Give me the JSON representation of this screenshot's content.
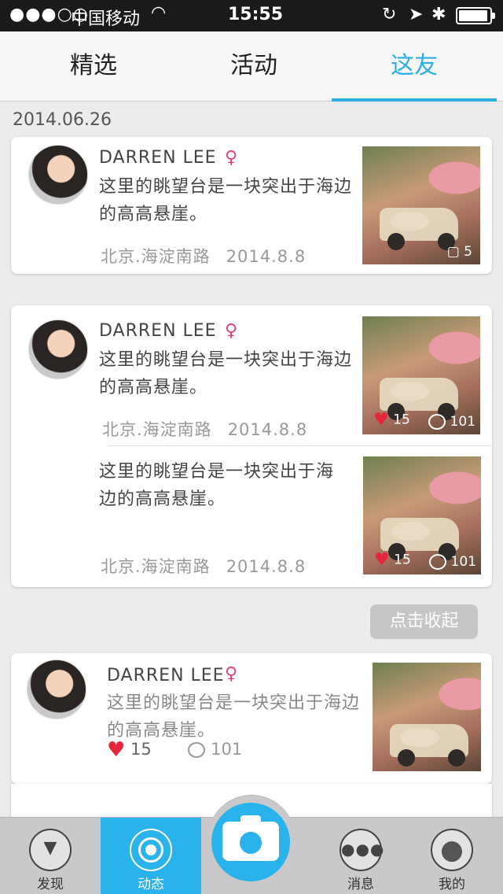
{
  "status_bar": {
    "signal": "●●●○○",
    "carrier": "中国移动",
    "time": "15:55",
    "battery_level": 0.95
  },
  "tabs": [
    "精选",
    "活动",
    "这友"
  ],
  "active_tab": "这友",
  "date": "2014.06.26",
  "cards": [
    {
      "name": "DARREN LEE",
      "gender": "♀",
      "text": "这里的眺望台是一块突出于海边的高高悬崖。",
      "location": "北京.海淀南路",
      "date": "2014.8.8",
      "photo_count": "5"
    },
    {
      "name": "DARREN LEE",
      "gender": "♀",
      "text": "这里的眺望台是一块突出于海边的高高悬崖。",
      "location": "北京.海淀南路",
      "date": "2014.8.8",
      "likes": "15",
      "comments": "101",
      "sub": {
        "text": "这里的眺望台是一块突出于海边的高高悬崖。",
        "location": "北京.海淀南路",
        "date": "2014.8.8",
        "likes": "15",
        "comments": "101"
      }
    },
    {
      "name": "DARREN LEE",
      "gender": "♀",
      "text": "这里的眺望台是一块突出于海边的高高悬崖。",
      "likes": "15",
      "comments": "101"
    }
  ],
  "collapse_label": "点击收起",
  "tabbar": {
    "discover": "发现",
    "feed": "动态",
    "messages": "消息",
    "mine": "我的"
  },
  "colors": {
    "accent": "#2baee6",
    "female": "#e0437a",
    "like": "#e3273a"
  },
  "icons": [
    "wifi-icon",
    "lock-rotation-icon",
    "location-icon",
    "bluetooth-icon",
    "battery-icon",
    "female-icon",
    "heart-icon",
    "comment-icon",
    "photos-icon",
    "camera-icon"
  ]
}
